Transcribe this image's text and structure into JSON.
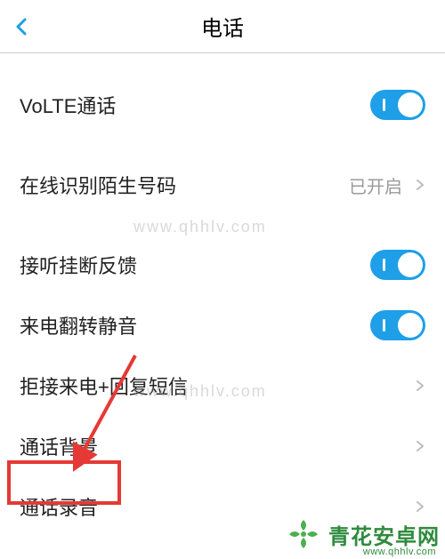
{
  "header": {
    "title": "电话"
  },
  "rows": {
    "volte": {
      "label": "VoLTE通话"
    },
    "stranger": {
      "label": "在线识别陌生号码",
      "value": "已开启"
    },
    "hangup": {
      "label": "接听挂断反馈"
    },
    "flip": {
      "label": "来电翻转静音"
    },
    "reject": {
      "label": "拒接来电+回复短信"
    },
    "bg": {
      "label": "通话背景"
    },
    "record": {
      "label": "通话录音"
    }
  },
  "watermark": {
    "line": "www.qhhlv.com"
  },
  "brand": {
    "name": "青花安卓网",
    "url": "www.qhhlv.com"
  }
}
